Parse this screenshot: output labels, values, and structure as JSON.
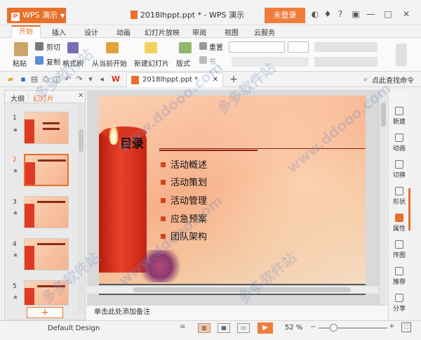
{
  "titlebar": {
    "app_menu": "WPS 演示",
    "doc_title": "2018lhppt.ppt * - WPS 演示",
    "login": "未登录",
    "icons": [
      "skin-icon",
      "shirt-icon",
      "help-icon",
      "minimize-icon",
      "restore-icon",
      "maximize-icon",
      "close-icon"
    ]
  },
  "ribbon_tabs": [
    "开始",
    "插入",
    "设计",
    "动画",
    "幻灯片放映",
    "审阅",
    "视图",
    "云服务"
  ],
  "ribbon": {
    "paste": "粘贴",
    "cut": "剪切",
    "copy": "复制",
    "format_painter": "格式刷",
    "from_current": "从当前开始",
    "new_slide": "新建幻灯片",
    "layout": "版式",
    "reset": "重置",
    "section": "节"
  },
  "doc_tab": "2018lhppt.ppt *",
  "search_cmd": "点此查找命令",
  "left_panel": {
    "tab_outline": "大纲",
    "tab_slides": "幻灯片",
    "slides": [
      {
        "number": "1",
        "selected": false
      },
      {
        "number": "2",
        "selected": true
      },
      {
        "number": "3",
        "selected": false
      },
      {
        "number": "4",
        "selected": false
      },
      {
        "number": "5",
        "selected": false
      }
    ],
    "add": "+"
  },
  "slide": {
    "title": "目录",
    "items": [
      "活动概述",
      "活动策划",
      "活动管理",
      "应急预案",
      "团队架构"
    ]
  },
  "right_sidebar": [
    "新建",
    "动画",
    "切换",
    "形状",
    "属性",
    "传图",
    "推荐",
    "分享"
  ],
  "notes_placeholder": "单击此处添加备注",
  "status": {
    "theme": "Default Design",
    "zoom": "52 %",
    "minus": "−",
    "plus": "+"
  },
  "watermark": [
    "多多软件站",
    "www.ddooo.com"
  ],
  "colors": {
    "accent": "#e8702a",
    "login": "#f07c3c"
  }
}
